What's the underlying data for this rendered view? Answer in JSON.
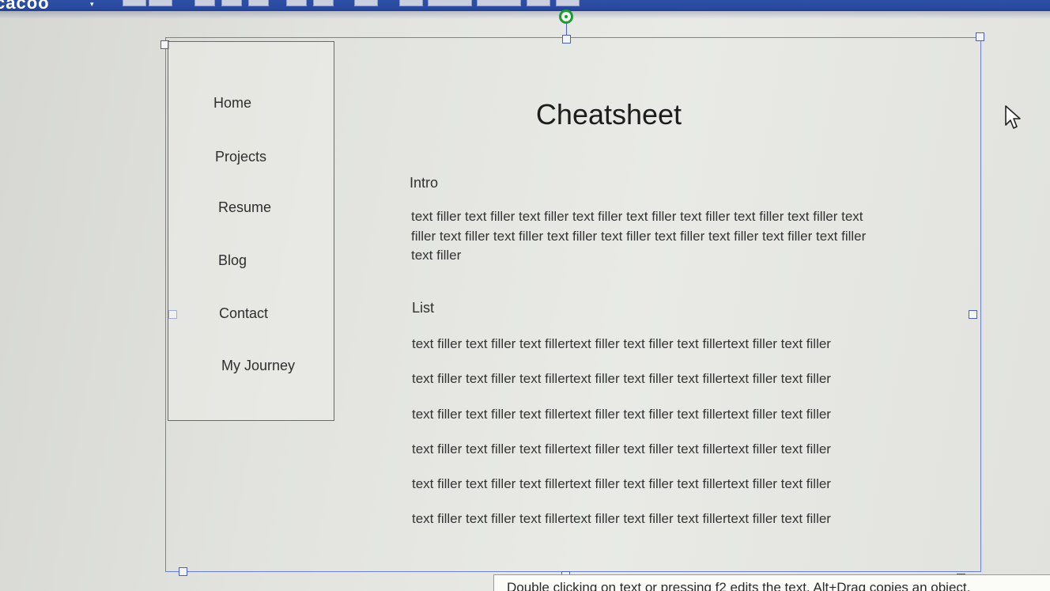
{
  "app": {
    "logo_text": "cacoo"
  },
  "sidebar": {
    "items": [
      {
        "label": "Home"
      },
      {
        "label": "Projects"
      },
      {
        "label": "Resume"
      },
      {
        "label": "Blog"
      },
      {
        "label": "Contact"
      },
      {
        "label": "My Journey"
      }
    ]
  },
  "main": {
    "title": "Cheatsheet",
    "intro": {
      "heading": "Intro",
      "body": "text filler text filler text filler text filler text filler text filler text filler text filler text filler text filler text filler text filler text filler text filler text filler text filler text filler text filler"
    },
    "list": {
      "heading": "List",
      "items": [
        "text filler text filler text fillertext filler text filler text fillertext filler text filler",
        "text filler text filler text fillertext filler text filler text fillertext filler text filler",
        "text filler text filler text fillertext filler text filler text fillertext filler text filler",
        "text filler text filler text fillertext filler text filler text fillertext filler text filler",
        "text filler text filler text fillertext filler text filler text fillertext filler text filler",
        "text filler text filler text fillertext filler text filler text fillertext filler text filler"
      ]
    }
  },
  "tooltip": {
    "text": "Double clicking on text or pressing f2 edits the text. Alt+Drag copies an object."
  },
  "colors": {
    "toolbar": "#2a4aa0",
    "selection": "#6f7fd0",
    "rotate_handle": "#1e9a35"
  }
}
